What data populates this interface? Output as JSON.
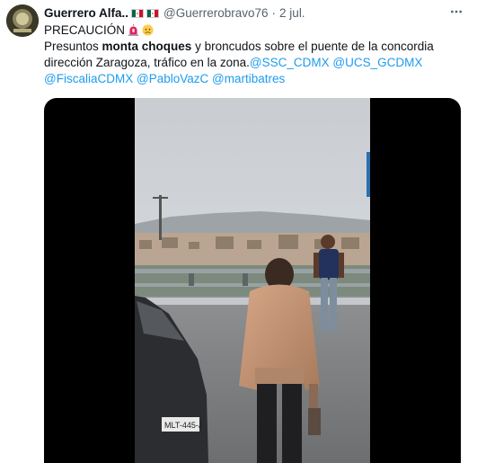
{
  "tweet": {
    "display_name": "Guerrero Alfa..",
    "handle": "@Guerrerobravo76",
    "separator": "·",
    "timestamp": "2 jul.",
    "more_icon": "ellipsis-icon",
    "lines": {
      "l1_text": "PRECAUCIÓN",
      "l2_pre": "Presuntos ",
      "l2_bold": "monta choques",
      "l2_post": " y broncudos sobre el puente de la concordia",
      "l3_text": "dirección Zaragoza, tráfico en la zona.",
      "l3_mention1": "@SSC_CDMX",
      "l3_mention2": "@UCS_GCDMX",
      "l4_mention1": "@FiscaliaCDMX",
      "l4_mention2": "@PabloVazC",
      "l4_mention3": "@martibatres"
    },
    "emojis": [
      "siren-emoji",
      "worried-face-emoji"
    ],
    "flags": [
      "mexico-flag",
      "mexico-flag"
    ],
    "video_plate": "MLT-445-J"
  },
  "colors": {
    "link": "#1d9bf0",
    "secondary_text": "#536471",
    "media_background": "#000000"
  }
}
